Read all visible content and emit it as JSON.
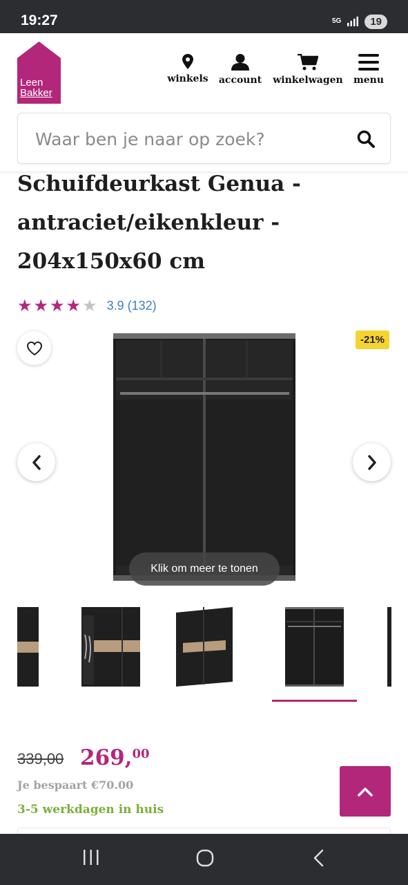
{
  "status_bar": {
    "time": "19:27",
    "network": "5G",
    "battery": "19"
  },
  "header": {
    "logo": {
      "line1": "Leen",
      "line2": "Bakker",
      "color": "#b3277a"
    },
    "nav": [
      {
        "label": "winkels",
        "icon": "location-pin-icon"
      },
      {
        "label": "account",
        "icon": "user-icon"
      },
      {
        "label": "winkelwagen",
        "icon": "cart-icon"
      },
      {
        "label": "menu",
        "icon": "hamburger-icon"
      }
    ],
    "search_placeholder": "Waar ben je naar op zoek?"
  },
  "product": {
    "title": "Schuifdeurkast Genua - antraciet/eikenkleur - 204x150x60 cm",
    "rating": {
      "stars": 3.9,
      "display": "3.9 (132)",
      "max_stars": 5
    },
    "discount_badge": "-21%",
    "tooltip": "Klik om meer te tonen",
    "selected_thumbnail": 4,
    "thumbnail_count": 5
  },
  "pricing": {
    "old_price": "339,00",
    "price_main": "269,",
    "price_cents": "00",
    "savings": "Je bespaart €70.00",
    "delivery": "3-5 werkdagen in huis"
  },
  "colors": {
    "brand": "#b3277a",
    "badge": "#f5d431",
    "delivery": "#7ab03a",
    "rating_text": "#3a7fc1"
  }
}
